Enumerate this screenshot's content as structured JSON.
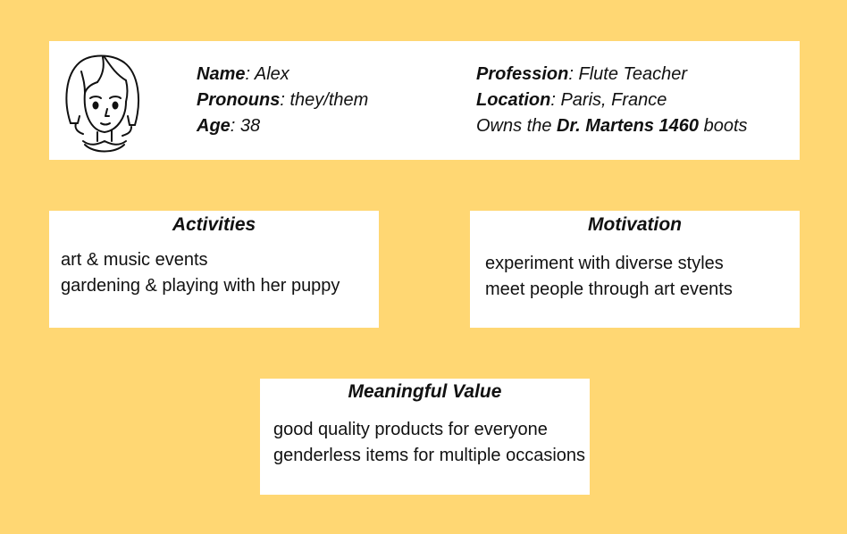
{
  "profile": {
    "name_label": "Name",
    "name_value": ": Alex",
    "pronouns_label": "Pronouns",
    "pronouns_value": ": they/them",
    "age_label": "Age",
    "age_value": ": 38",
    "profession_label": "Profession",
    "profession_value": ": Flute Teacher",
    "location_label": "Location",
    "location_value": ": Paris, France",
    "owns_prefix": "Owns the ",
    "owns_product": "Dr. Martens 1460",
    "owns_suffix": " boots",
    "avatar_icon": "avatar-sketch"
  },
  "activities": {
    "title": "Activities",
    "lines": [
      "art & music events",
      "gardening & playing with her puppy"
    ]
  },
  "motivation": {
    "title": "Motivation",
    "lines": [
      "experiment with diverse styles",
      "meet people through art events"
    ]
  },
  "meaningful_value": {
    "title": "Meaningful Value",
    "lines": [
      "good quality products for everyone",
      "genderless items for multiple occasions"
    ]
  },
  "colors": {
    "background": "#FFD773",
    "card": "#FFFFFF",
    "text": "#111111"
  }
}
